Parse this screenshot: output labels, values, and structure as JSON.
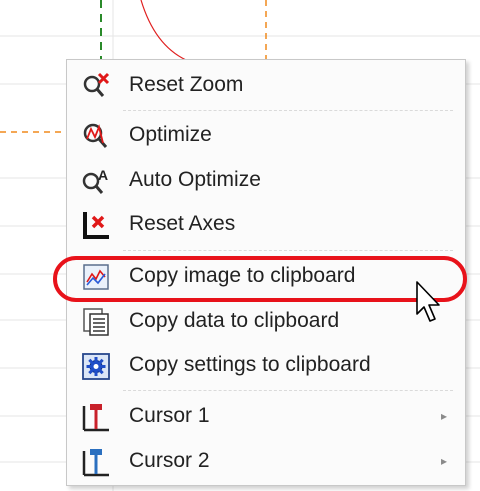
{
  "menu": {
    "items": [
      {
        "label": "Reset Zoom",
        "icon": "reset-zoom-icon"
      },
      {
        "label": "Optimize",
        "icon": "optimize-icon"
      },
      {
        "label": "Auto Optimize",
        "icon": "auto-optimize-icon"
      },
      {
        "label": "Reset Axes",
        "icon": "reset-axes-icon"
      },
      {
        "label": "Copy image to clipboard",
        "icon": "copy-image-icon",
        "highlighted": true
      },
      {
        "label": "Copy data to clipboard",
        "icon": "copy-data-icon"
      },
      {
        "label": "Copy settings to clipboard",
        "icon": "copy-settings-icon"
      },
      {
        "label": "Cursor 1",
        "icon": "cursor-1-icon",
        "submenu": true
      },
      {
        "label": "Cursor 2",
        "icon": "cursor-2-icon",
        "submenu": true
      }
    ],
    "submenu_arrow": "▸"
  },
  "colors": {
    "highlight": "#e8121a",
    "grid_line": "#e6e6e6",
    "cursor_line": "#f08a1c",
    "trace": "#e02020",
    "green_cursor": "#2a8a2a"
  }
}
